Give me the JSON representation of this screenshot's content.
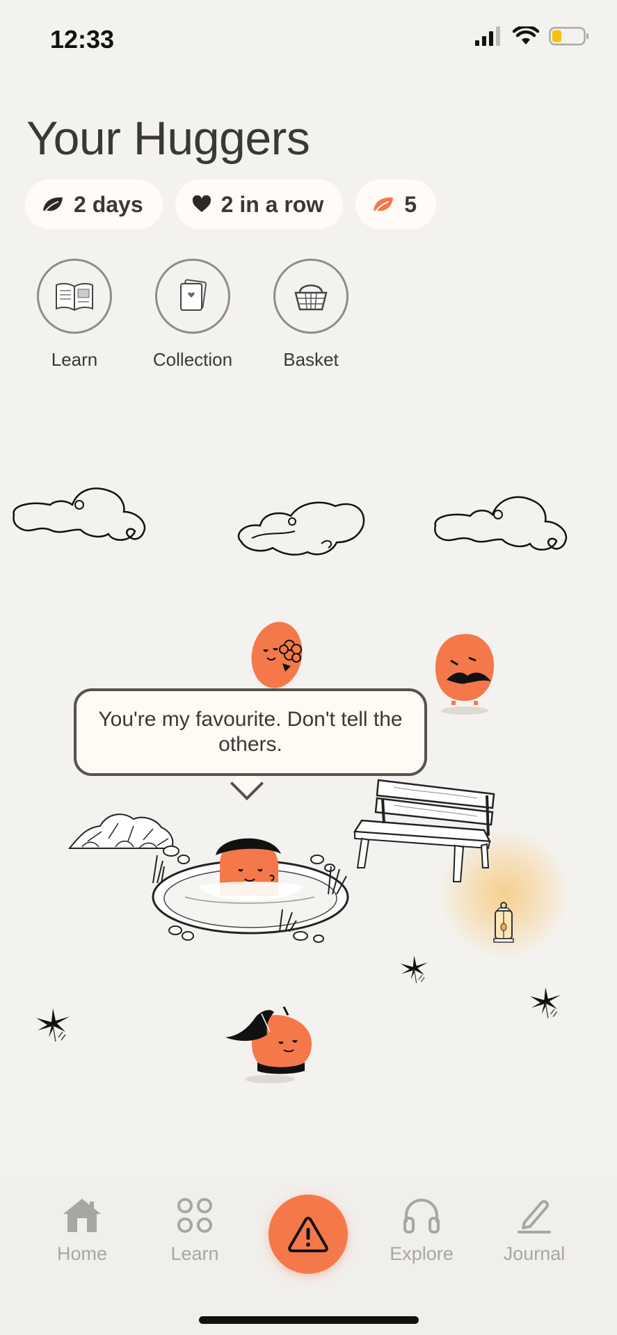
{
  "status": {
    "time": "12:33"
  },
  "header": {
    "title": "Your Huggers"
  },
  "chips": [
    {
      "icon": "leaf-icon",
      "label": "2 days"
    },
    {
      "icon": "heart-icon",
      "label": "2 in a row"
    },
    {
      "icon": "orange-leaf-icon",
      "label": "5"
    }
  ],
  "actions": [
    {
      "icon": "book-icon",
      "label": "Learn"
    },
    {
      "icon": "cards-icon",
      "label": "Collection"
    },
    {
      "icon": "basket-icon",
      "label": "Basket"
    }
  ],
  "speech_bubble": {
    "text": "You're my favourite. Don't tell the others."
  },
  "tabbar": {
    "items": [
      {
        "icon": "home-icon",
        "label": "Home"
      },
      {
        "icon": "grid-icon",
        "label": "Learn"
      },
      {
        "icon": "alert-icon",
        "label": ""
      },
      {
        "icon": "headphones-icon",
        "label": "Explore"
      },
      {
        "icon": "pencil-icon",
        "label": "Journal"
      }
    ]
  },
  "colors": {
    "accent": "#f5784a",
    "background": "#f4f2ee",
    "chip_bg": "#fffcf7",
    "tab_inactive": "#a8a6a3"
  }
}
